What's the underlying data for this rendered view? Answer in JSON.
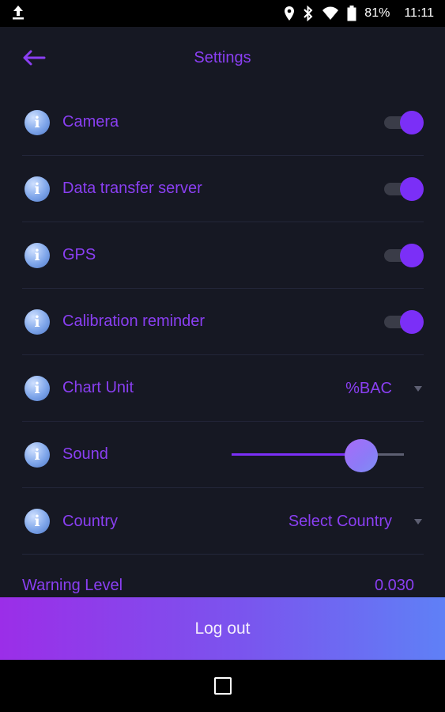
{
  "status_bar": {
    "battery": "81%",
    "time": "11:11",
    "icons": [
      "upload-icon",
      "location-icon",
      "bluetooth-icon",
      "wifi-icon",
      "battery-icon"
    ]
  },
  "header": {
    "title": "Settings",
    "back_icon": "arrow-left-icon"
  },
  "settings": {
    "camera": {
      "label": "Camera",
      "enabled": true
    },
    "data_transfer": {
      "label": "Data transfer server",
      "enabled": true
    },
    "gps": {
      "label": "GPS",
      "enabled": true
    },
    "calibration": {
      "label": "Calibration reminder",
      "enabled": true
    },
    "chart_unit": {
      "label": "Chart Unit",
      "value": "%BAC"
    },
    "sound": {
      "label": "Sound",
      "level": 0.75
    },
    "country": {
      "label": "Country",
      "value": "Select Country"
    }
  },
  "info_icon": "i",
  "warning": {
    "label": "Warning Level",
    "value": "0.030"
  },
  "logout": {
    "label": "Log out"
  },
  "colors": {
    "accent": "#8a3ff2",
    "toggle_on": "#7b2ff7",
    "background": "#161823",
    "logout_start": "#9b2ee8",
    "logout_end": "#5f80f6"
  }
}
